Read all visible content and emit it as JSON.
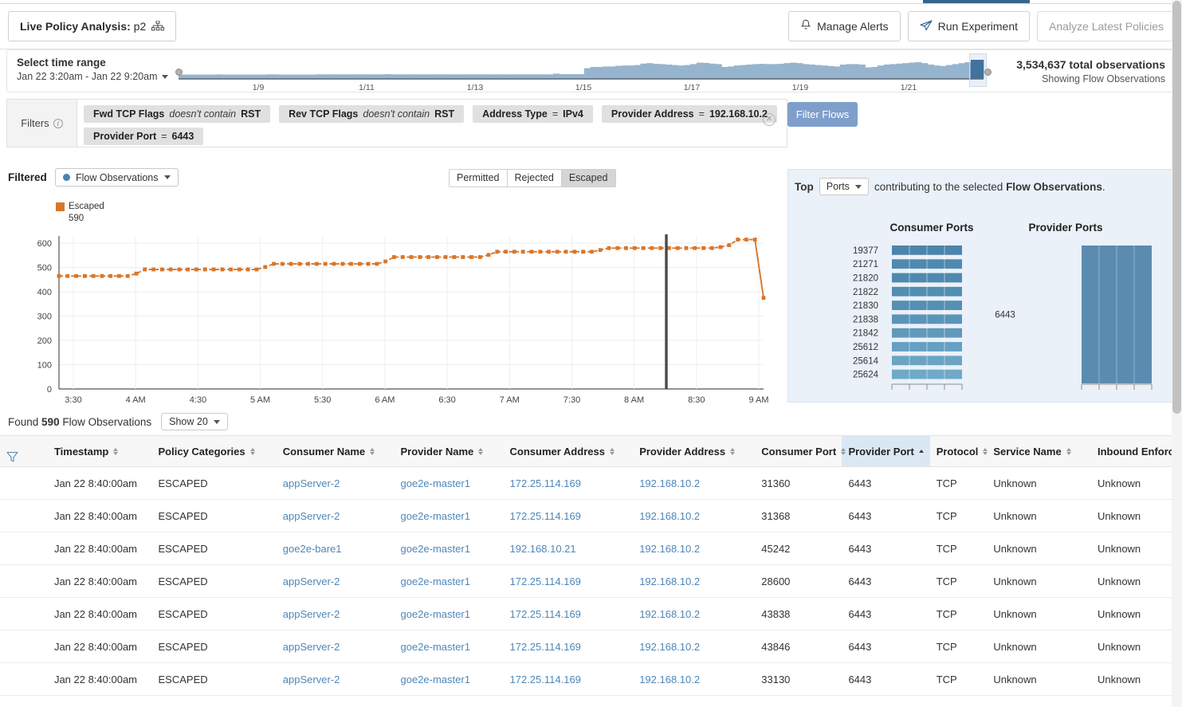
{
  "header": {
    "title_prefix": "Live Policy Analysis:",
    "title_value": "p2",
    "sitemap_icon": "sitemap-icon",
    "buttons": [
      {
        "label": "Manage Alerts",
        "icon": "bell-icon",
        "disabled": false
      },
      {
        "label": "Run Experiment",
        "icon": "paper-plane-icon",
        "disabled": false
      },
      {
        "label": "Analyze Latest Policies",
        "icon": "none",
        "disabled": true
      }
    ]
  },
  "time_range": {
    "label": "Select time range",
    "value": "Jan 22 3:20am - Jan 22 9:20am",
    "caret_icon": "chevron-down-icon",
    "ticks": [
      "1/9",
      "1/11",
      "1/13",
      "1/15",
      "1/17",
      "1/19",
      "1/21"
    ],
    "total_observations": "3,534,637 total observations",
    "showing": "Showing Flow Observations"
  },
  "filters": {
    "label": "Filters",
    "info_icon": "info-icon",
    "clear_icon": "clear-circle-icon",
    "chips": [
      {
        "key": "Fwd TCP Flags",
        "op": "doesn't contain",
        "op_italic": true,
        "value": "RST"
      },
      {
        "key": "Rev TCP Flags",
        "op": "doesn't contain",
        "op_italic": true,
        "value": "RST"
      },
      {
        "key": "Address Type",
        "op": "=",
        "op_italic": false,
        "value": "IPv4"
      },
      {
        "key": "Provider Address",
        "op": "=",
        "op_italic": false,
        "value": "192.168.10.2"
      },
      {
        "key": "Provider Port",
        "op": "=",
        "op_italic": false,
        "value": "6443"
      }
    ],
    "apply_button": "Filter Flows"
  },
  "chart_panel": {
    "filtered_label": "Filtered",
    "observations_dropdown": "Flow Observations",
    "segmented": [
      {
        "label": "Permitted",
        "selected": false
      },
      {
        "label": "Rejected",
        "selected": false
      },
      {
        "label": "Escaped",
        "selected": true
      }
    ]
  },
  "chart_data": {
    "type": "line",
    "title": "",
    "xlabel": "",
    "ylabel": "",
    "legend": [
      "Escaped"
    ],
    "legend_position": "top-left",
    "series_color": "#d9762b",
    "peak_annotation": "590",
    "ylim": [
      0,
      630
    ],
    "yticks": [
      0,
      100,
      200,
      300,
      400,
      500,
      600
    ],
    "grid": true,
    "xticks": [
      "3:30",
      "4 AM",
      "4:30",
      "5 AM",
      "5:30",
      "6 AM",
      "6:30",
      "7 AM",
      "7:30",
      "8 AM",
      "8:30",
      "9 AM"
    ],
    "marker_line_x": "8:42",
    "series": [
      {
        "name": "Escaped",
        "values": [
          465,
          465,
          465,
          465,
          465,
          465,
          465,
          465,
          465,
          475,
          492,
          492,
          492,
          492,
          492,
          492,
          492,
          492,
          492,
          492,
          492,
          492,
          492,
          492,
          502,
          515,
          515,
          515,
          515,
          515,
          515,
          515,
          515,
          515,
          515,
          515,
          515,
          515,
          525,
          543,
          543,
          543,
          543,
          543,
          543,
          543,
          543,
          543,
          543,
          543,
          552,
          565,
          565,
          565,
          565,
          565,
          565,
          565,
          565,
          565,
          565,
          565,
          565,
          572,
          580,
          580,
          580,
          580,
          580,
          580,
          580,
          580,
          580,
          580,
          580,
          580,
          580,
          584,
          592,
          615,
          615,
          615,
          375
        ]
      }
    ]
  },
  "top_ports": {
    "prefix": "Top",
    "dropdown": "Ports",
    "suffix_1": "contributing to the selected",
    "suffix_bold": "Flow Observations",
    "suffix_2": ".",
    "caret_icon": "chevron-down-icon",
    "consumer_title": "Consumer Ports",
    "provider_title": "Provider Ports",
    "consumer_ports": [
      {
        "label": "19377",
        "value": 100
      },
      {
        "label": "21271",
        "value": 100
      },
      {
        "label": "21820",
        "value": 100
      },
      {
        "label": "21822",
        "value": 100
      },
      {
        "label": "21830",
        "value": 100
      },
      {
        "label": "21838",
        "value": 100
      },
      {
        "label": "21842",
        "value": 100
      },
      {
        "label": "25612",
        "value": 100
      },
      {
        "label": "25614",
        "value": 100
      },
      {
        "label": "25624",
        "value": 100
      }
    ],
    "provider_ports": [
      {
        "label": "6443",
        "value": 100
      }
    ]
  },
  "results": {
    "found_prefix": "Found",
    "found_count": "590",
    "found_suffix": "Flow Observations",
    "show_dropdown": "Show 20",
    "filter_icon": "funnel-icon",
    "columns": [
      {
        "label": "Timestamp",
        "sort": "both"
      },
      {
        "label": "Policy Categories",
        "sort": "both"
      },
      {
        "label": "Consumer Name",
        "sort": "both"
      },
      {
        "label": "Provider Name",
        "sort": "both"
      },
      {
        "label": "Consumer Address",
        "sort": "both"
      },
      {
        "label": "Provider Address",
        "sort": "both"
      },
      {
        "label": "Consumer Port",
        "sort": "both"
      },
      {
        "label": "Provider Port",
        "sort": "asc"
      },
      {
        "label": "Protocol",
        "sort": "both"
      },
      {
        "label": "Service Name",
        "sort": "both"
      },
      {
        "label": "Inbound Enforceme",
        "sort": "none"
      }
    ],
    "rows": [
      {
        "timestamp": "Jan 22 8:40:00am",
        "policy": "ESCAPED",
        "consumer_name": "appServer-2",
        "provider_name": "goe2e-master1",
        "consumer_address": "172.25.114.169",
        "provider_address": "192.168.10.2",
        "consumer_port": "31360",
        "provider_port": "6443",
        "protocol": "TCP",
        "service_name": "Unknown",
        "inbound": "Unknown"
      },
      {
        "timestamp": "Jan 22 8:40:00am",
        "policy": "ESCAPED",
        "consumer_name": "appServer-2",
        "provider_name": "goe2e-master1",
        "consumer_address": "172.25.114.169",
        "provider_address": "192.168.10.2",
        "consumer_port": "31368",
        "provider_port": "6443",
        "protocol": "TCP",
        "service_name": "Unknown",
        "inbound": "Unknown"
      },
      {
        "timestamp": "Jan 22 8:40:00am",
        "policy": "ESCAPED",
        "consumer_name": "goe2e-bare1",
        "provider_name": "goe2e-master1",
        "consumer_address": "192.168.10.21",
        "provider_address": "192.168.10.2",
        "consumer_port": "45242",
        "provider_port": "6443",
        "protocol": "TCP",
        "service_name": "Unknown",
        "inbound": "Unknown"
      },
      {
        "timestamp": "Jan 22 8:40:00am",
        "policy": "ESCAPED",
        "consumer_name": "appServer-2",
        "provider_name": "goe2e-master1",
        "consumer_address": "172.25.114.169",
        "provider_address": "192.168.10.2",
        "consumer_port": "28600",
        "provider_port": "6443",
        "protocol": "TCP",
        "service_name": "Unknown",
        "inbound": "Unknown"
      },
      {
        "timestamp": "Jan 22 8:40:00am",
        "policy": "ESCAPED",
        "consumer_name": "appServer-2",
        "provider_name": "goe2e-master1",
        "consumer_address": "172.25.114.169",
        "provider_address": "192.168.10.2",
        "consumer_port": "43838",
        "provider_port": "6443",
        "protocol": "TCP",
        "service_name": "Unknown",
        "inbound": "Unknown"
      },
      {
        "timestamp": "Jan 22 8:40:00am",
        "policy": "ESCAPED",
        "consumer_name": "appServer-2",
        "provider_name": "goe2e-master1",
        "consumer_address": "172.25.114.169",
        "provider_address": "192.168.10.2",
        "consumer_port": "43846",
        "provider_port": "6443",
        "protocol": "TCP",
        "service_name": "Unknown",
        "inbound": "Unknown"
      },
      {
        "timestamp": "Jan 22 8:40:00am",
        "policy": "ESCAPED",
        "consumer_name": "appServer-2",
        "provider_name": "goe2e-master1",
        "consumer_address": "172.25.114.169",
        "provider_address": "192.168.10.2",
        "consumer_port": "33130",
        "provider_port": "6443",
        "protocol": "TCP",
        "service_name": "Unknown",
        "inbound": "Unknown"
      }
    ]
  },
  "colors": {
    "accent_blue": "#35658f",
    "link_blue": "#4f87b8",
    "series_orange": "#d9762b",
    "bar_blue": "#5b8cb0",
    "panel_blue": "#eaf1f8",
    "button_blue": "#7e9fcb"
  },
  "timeline_histogram": [
    0.18,
    0.18,
    0.18,
    0.18,
    0.18,
    0.18,
    0.19,
    0.18,
    0.18,
    0.18,
    0.18,
    0.18,
    0.18,
    0.18,
    0.19,
    0.19,
    0.18,
    0.18,
    0.18,
    0.18,
    0.18,
    0.18,
    0.19,
    0.19,
    0.19,
    0.19,
    0.19,
    0.19,
    0.19,
    0.19,
    0.19,
    0.19,
    0.19,
    0.2,
    0.19,
    0.19,
    0.19,
    0.19,
    0.19,
    0.19,
    0.19,
    0.19,
    0.19,
    0.19,
    0.19,
    0.19,
    0.19,
    0.19,
    0.19,
    0.19,
    0.19,
    0.19,
    0.19,
    0.19,
    0.19,
    0.19,
    0.19,
    0.19,
    0.19,
    0.19,
    0.22,
    0.2,
    0.2,
    0.2,
    0.2,
    0.45,
    0.5,
    0.5,
    0.52,
    0.52,
    0.55,
    0.56,
    0.56,
    0.58,
    0.64,
    0.66,
    0.63,
    0.62,
    0.6,
    0.58,
    0.56,
    0.58,
    0.62,
    0.68,
    0.67,
    0.64,
    0.62,
    0.5,
    0.52,
    0.56,
    0.58,
    0.6,
    0.62,
    0.63,
    0.62,
    0.62,
    0.63,
    0.66,
    0.68,
    0.66,
    0.62,
    0.6,
    0.58,
    0.56,
    0.54,
    0.52,
    0.6,
    0.62,
    0.62,
    0.6,
    0.48,
    0.5,
    0.56,
    0.6,
    0.62,
    0.64,
    0.66,
    0.68,
    0.7,
    0.66,
    0.6,
    0.56,
    0.54,
    0.58,
    0.62,
    0.66,
    0.7,
    0.74,
    0.8
  ]
}
